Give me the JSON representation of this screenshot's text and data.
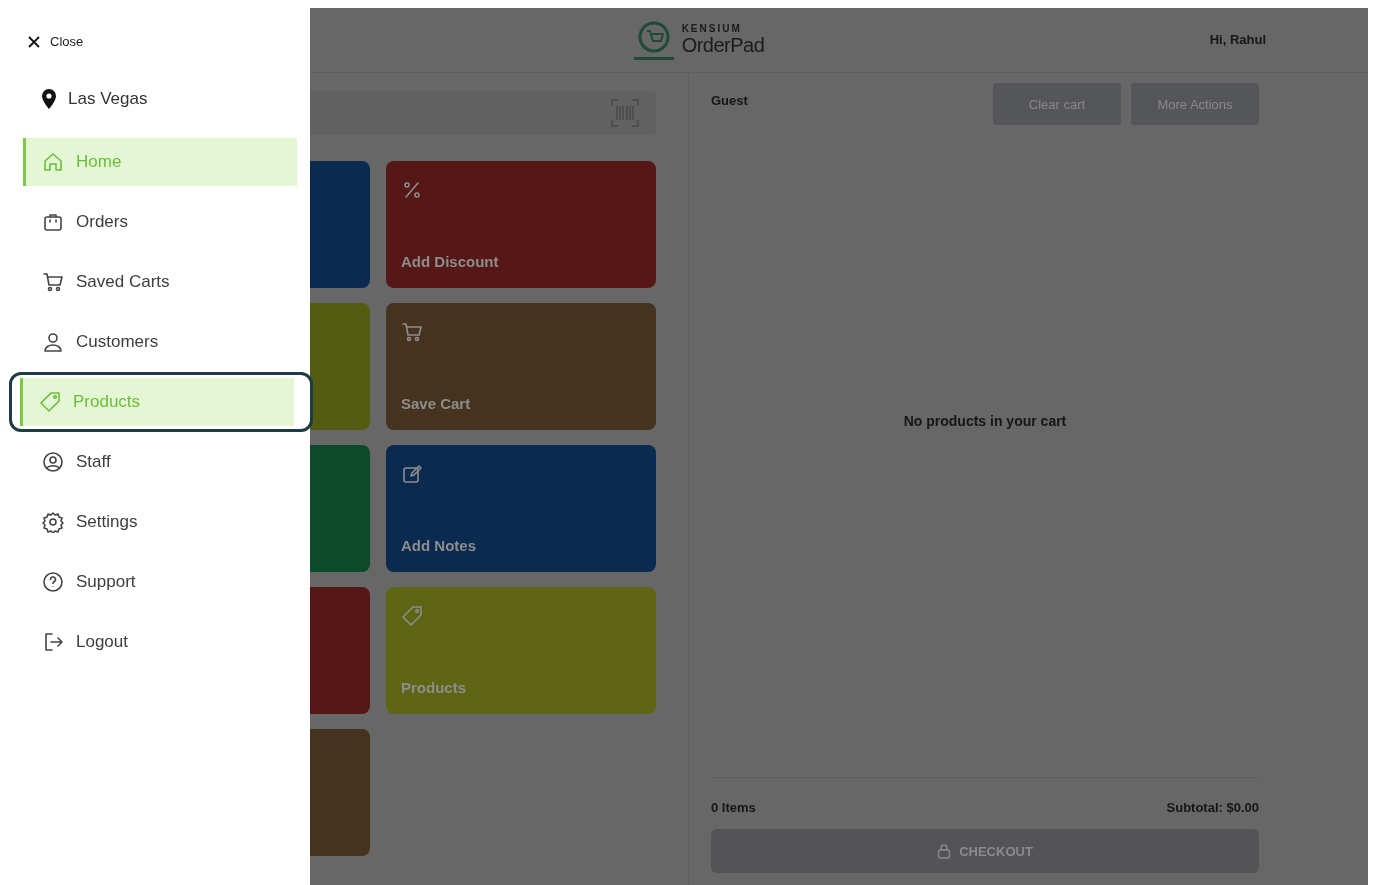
{
  "drawer": {
    "close_label": "Close",
    "location": "Las Vegas",
    "nav": [
      {
        "label": "Home",
        "selected": true,
        "focused": false
      },
      {
        "label": "Orders",
        "selected": false,
        "focused": false
      },
      {
        "label": "Saved Carts",
        "selected": false,
        "focused": false
      },
      {
        "label": "Customers",
        "selected": false,
        "focused": false
      },
      {
        "label": "Products",
        "selected": true,
        "focused": true
      },
      {
        "label": "Staff",
        "selected": false,
        "focused": false
      },
      {
        "label": "Settings",
        "selected": false,
        "focused": false
      },
      {
        "label": "Support",
        "selected": false,
        "focused": false
      },
      {
        "label": "Logout",
        "selected": false,
        "focused": false
      }
    ]
  },
  "header": {
    "brand_small": "KENSIUM",
    "brand": "OrderPad",
    "greeting": "Hi, Rahul"
  },
  "tiles": [
    {
      "color": "#0a2a4f"
    },
    {
      "label": "Add Discount",
      "color": "#561717"
    },
    {
      "color": "#545c12"
    },
    {
      "label": "Save Cart",
      "color": "#45331f"
    },
    {
      "color": "#0b4b2a"
    },
    {
      "label": "Add Notes",
      "color": "#0a2a4f"
    },
    {
      "color": "#561717"
    },
    {
      "label": "Products",
      "color": "#5e6614"
    },
    {
      "color": "#45331f"
    }
  ],
  "cart": {
    "customer": "Guest",
    "actions": [
      {
        "label": "Clear cart",
        "disabled": true
      },
      {
        "label": "More Actions",
        "disabled": true
      }
    ],
    "empty_message": "No products in your cart",
    "items_count": "0 Items",
    "subtotal": "Subtotal: $0.00",
    "checkout": {
      "label": "CHECKOUT",
      "disabled": true
    }
  }
}
